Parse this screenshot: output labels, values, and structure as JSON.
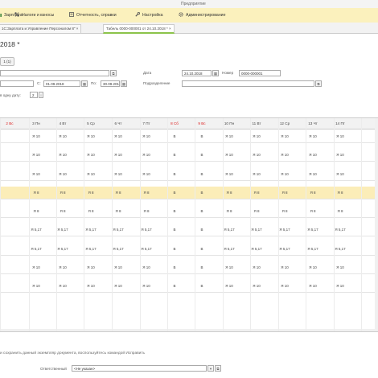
{
  "window": {
    "title": "Предприятие"
  },
  "menu": [
    {
      "label": "Зарплата",
      "icon": "chart-icon",
      "color": "#2e7d32"
    },
    {
      "label": "Налоги и взносы",
      "icon": "percent-icon",
      "color": "#555555"
    },
    {
      "label": "Отчетность, справки",
      "icon": "report-icon",
      "color": "#555555"
    },
    {
      "label": "Настройка",
      "icon": "wrench-icon",
      "color": "#555555"
    },
    {
      "label": "Администрирование",
      "icon": "gear-icon",
      "color": "#555555"
    }
  ],
  "tabs": [
    {
      "label": "1С:Зарплата и Управление Персоналом 8\" ×"
    },
    {
      "label": "Табель 0000-000001 от 24.10.2018 * ×"
    }
  ],
  "document": {
    "title": "2018 *",
    "btn_label": "1 (1)",
    "date_label": "Дата",
    "date_value": "24.10.2018",
    "number_label": "Номер",
    "number_value": "0000-000001",
    "period_from_label": "С:",
    "period_from": "01.09.2018",
    "period_to_label": "По:",
    "period_to": "30.09.2018",
    "department_label": "Подразделение",
    "one_day_label": "в одну дату:",
    "one_day_value": "2",
    "hint": "и сохранить данный экземпляр документа, воспользуйтесь командой Исправить",
    "responsible_label": "Ответственный",
    "responsible_value": "<Не указан>"
  },
  "grid": {
    "columns": [
      {
        "label": "2 Вс",
        "weekend": true
      },
      {
        "label": "3 Пн",
        "weekend": false
      },
      {
        "label": "4 Вт",
        "weekend": false
      },
      {
        "label": "5 Ср",
        "weekend": false
      },
      {
        "label": "6 Чт",
        "weekend": false
      },
      {
        "label": "7 Пт",
        "weekend": false
      },
      {
        "label": "8 Сб",
        "weekend": true
      },
      {
        "label": "9 Вс",
        "weekend": true
      },
      {
        "label": "10 Пн",
        "weekend": false
      },
      {
        "label": "11 Вт",
        "weekend": false
      },
      {
        "label": "12 Ср",
        "weekend": false
      },
      {
        "label": "13 Чт",
        "weekend": false
      },
      {
        "label": "14 Пт",
        "weekend": false
      }
    ],
    "rows": [
      {
        "cells": [
          "",
          "Я 10",
          "Я 10",
          "Я 10",
          "Я 10",
          "Я 10",
          "В",
          "В",
          "Я 10",
          "Я 10",
          "Я 10",
          "Я 10",
          "Я 10"
        ],
        "highlight": false
      },
      {
        "cells": [
          "",
          "Я 10",
          "Я 10",
          "Я 10",
          "Я 10",
          "Я 10",
          "В",
          "В",
          "Я 10",
          "Я 10",
          "Я 10",
          "Я 10",
          "Я 10"
        ],
        "highlight": false
      },
      {
        "cells": [
          "",
          "Я 10",
          "Я 10",
          "Я 10",
          "Я 10",
          "Я 10",
          "В",
          "В",
          "Я 10",
          "Я 10",
          "Я 10",
          "Я 10",
          "Я 10"
        ],
        "highlight": false
      },
      {
        "cells": [
          "",
          "Я 8",
          "Я 8",
          "Я 8",
          "Я 8",
          "Я 8",
          "В",
          "В",
          "Я 8",
          "Я 8",
          "Я 8",
          "Я 8",
          "Я 8"
        ],
        "highlight": true
      },
      {
        "cells": [
          "",
          "Я 8",
          "Я 8",
          "Я 8",
          "Я 8",
          "Я 8",
          "В",
          "В",
          "Я 8",
          "Я 8",
          "Я 8",
          "Я 8",
          "Я 8"
        ],
        "highlight": false
      },
      {
        "cells": [
          "",
          "Я 5,17",
          "Я 5,17",
          "Я 5,17",
          "Я 5,17",
          "Я 5,17",
          "В",
          "В",
          "Я 5,17",
          "Я 5,17",
          "Я 5,17",
          "Я 5,17",
          "Я 5,17"
        ],
        "highlight": false
      },
      {
        "cells": [
          "",
          "Я 5,17",
          "Я 5,17",
          "Я 5,17",
          "Я 5,17",
          "Я 5,17",
          "В",
          "В",
          "Я 5,17",
          "Я 5,17",
          "Я 5,17",
          "Я 5,17",
          "Я 5,17"
        ],
        "highlight": false
      },
      {
        "cells": [
          "",
          "Я 10",
          "Я 10",
          "Я 10",
          "Я 10",
          "Я 10",
          "В",
          "В",
          "Я 10",
          "Я 10",
          "Я 10",
          "Я 10",
          "Я 10"
        ],
        "highlight": false
      },
      {
        "cells": [
          "",
          "Я 10",
          "Я 10",
          "Я 10",
          "Я 10",
          "Я 10",
          "В",
          "В",
          "Я 10",
          "Я 10",
          "Я 10",
          "Я 10",
          "Я 10"
        ],
        "highlight": false
      }
    ]
  },
  "colors": {
    "menu_bg": "#fbf1bd",
    "highlight_row": "#fbedb8",
    "weekend": "#dd2222",
    "active_tab": "#8cc34a"
  }
}
